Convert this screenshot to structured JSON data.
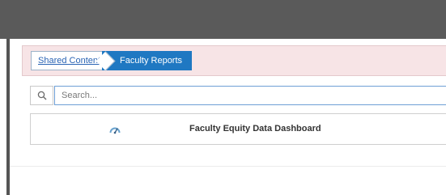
{
  "breadcrumb": {
    "link_label": "Shared Content",
    "current_label": "Faculty Reports"
  },
  "search": {
    "placeholder": "Search...",
    "value": ""
  },
  "dashboard": {
    "title": "Faculty Equity Data Dashboard",
    "icon": "gauge-icon"
  },
  "colors": {
    "breadcrumb_band": "#f7e4e6",
    "breadcrumb_active": "#1f78c2",
    "link": "#2a64b4",
    "top_bar": "#5a5a5a"
  }
}
